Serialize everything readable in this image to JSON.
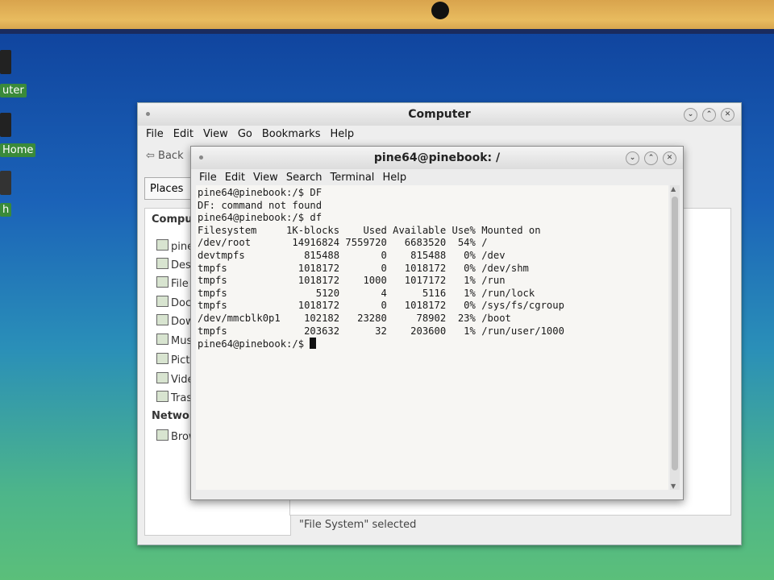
{
  "desktop": {
    "icons": [
      {
        "label": "uter"
      },
      {
        "label": "Home"
      },
      {
        "label": "h"
      }
    ]
  },
  "file_manager": {
    "title": "Computer",
    "menu": [
      "File",
      "Edit",
      "View",
      "Go",
      "Bookmarks",
      "Help"
    ],
    "back_label": "Back",
    "places_label": "Places",
    "section_computer": "Compu",
    "items": [
      "pine",
      "Desk",
      "File S",
      "Docu",
      "Dow",
      "Musi",
      "Pictu",
      "Vide",
      "Trash"
    ],
    "section_network": "Networ",
    "network_items": [
      "Brow"
    ],
    "status": "\"File System\" selected"
  },
  "terminal": {
    "title": "pine64@pinebook: /",
    "menu": [
      "File",
      "Edit",
      "View",
      "Search",
      "Terminal",
      "Help"
    ],
    "lines": [
      "pine64@pinebook:/$ DF",
      "DF: command not found",
      "pine64@pinebook:/$ df",
      "Filesystem     1K-blocks    Used Available Use% Mounted on",
      "/dev/root       14916824 7559720   6683520  54% /",
      "devtmpfs          815488       0    815488   0% /dev",
      "tmpfs            1018172       0   1018172   0% /dev/shm",
      "tmpfs            1018172    1000   1017172   1% /run",
      "tmpfs               5120       4      5116   1% /run/lock",
      "tmpfs            1018172       0   1018172   0% /sys/fs/cgroup",
      "/dev/mmcblk0p1    102182   23280     78902  23% /boot",
      "tmpfs             203632      32    203600   1% /run/user/1000"
    ],
    "prompt": "pine64@pinebook:/$ "
  }
}
